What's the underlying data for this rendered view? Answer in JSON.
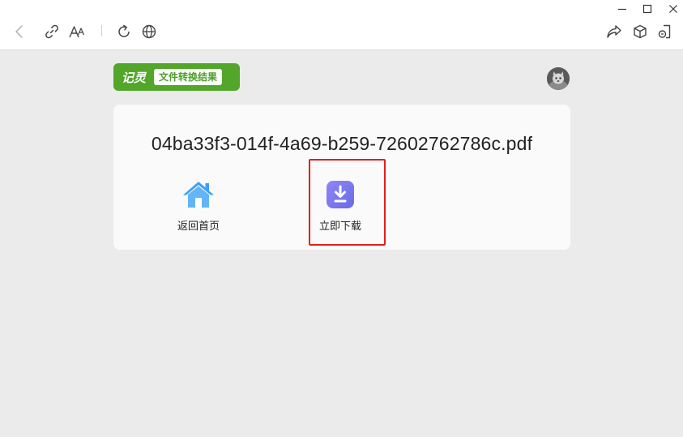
{
  "chrome": {
    "window_controls": [
      "minimize-icon",
      "maximize-icon",
      "close-icon"
    ],
    "toolbar_left": [
      "back-icon",
      "link-icon",
      "font-size-icon",
      "refresh-icon",
      "globe-icon"
    ],
    "toolbar_right": [
      "share-icon",
      "cube-icon",
      "extension-icon"
    ]
  },
  "brand": {
    "logo_text": "记灵",
    "page_tag": "文件转换结果",
    "color": "#52a62a"
  },
  "result": {
    "filename": "04ba33f3-014f-4a69-b259-72602762786c.pdf"
  },
  "actions": {
    "home_label": "返回首页",
    "download_label": "立即下载"
  },
  "colors": {
    "home_icon": "#3d9ff5",
    "download_icon": "#7a78f0",
    "highlight": "#e0201b",
    "background": "#ebebeb"
  }
}
